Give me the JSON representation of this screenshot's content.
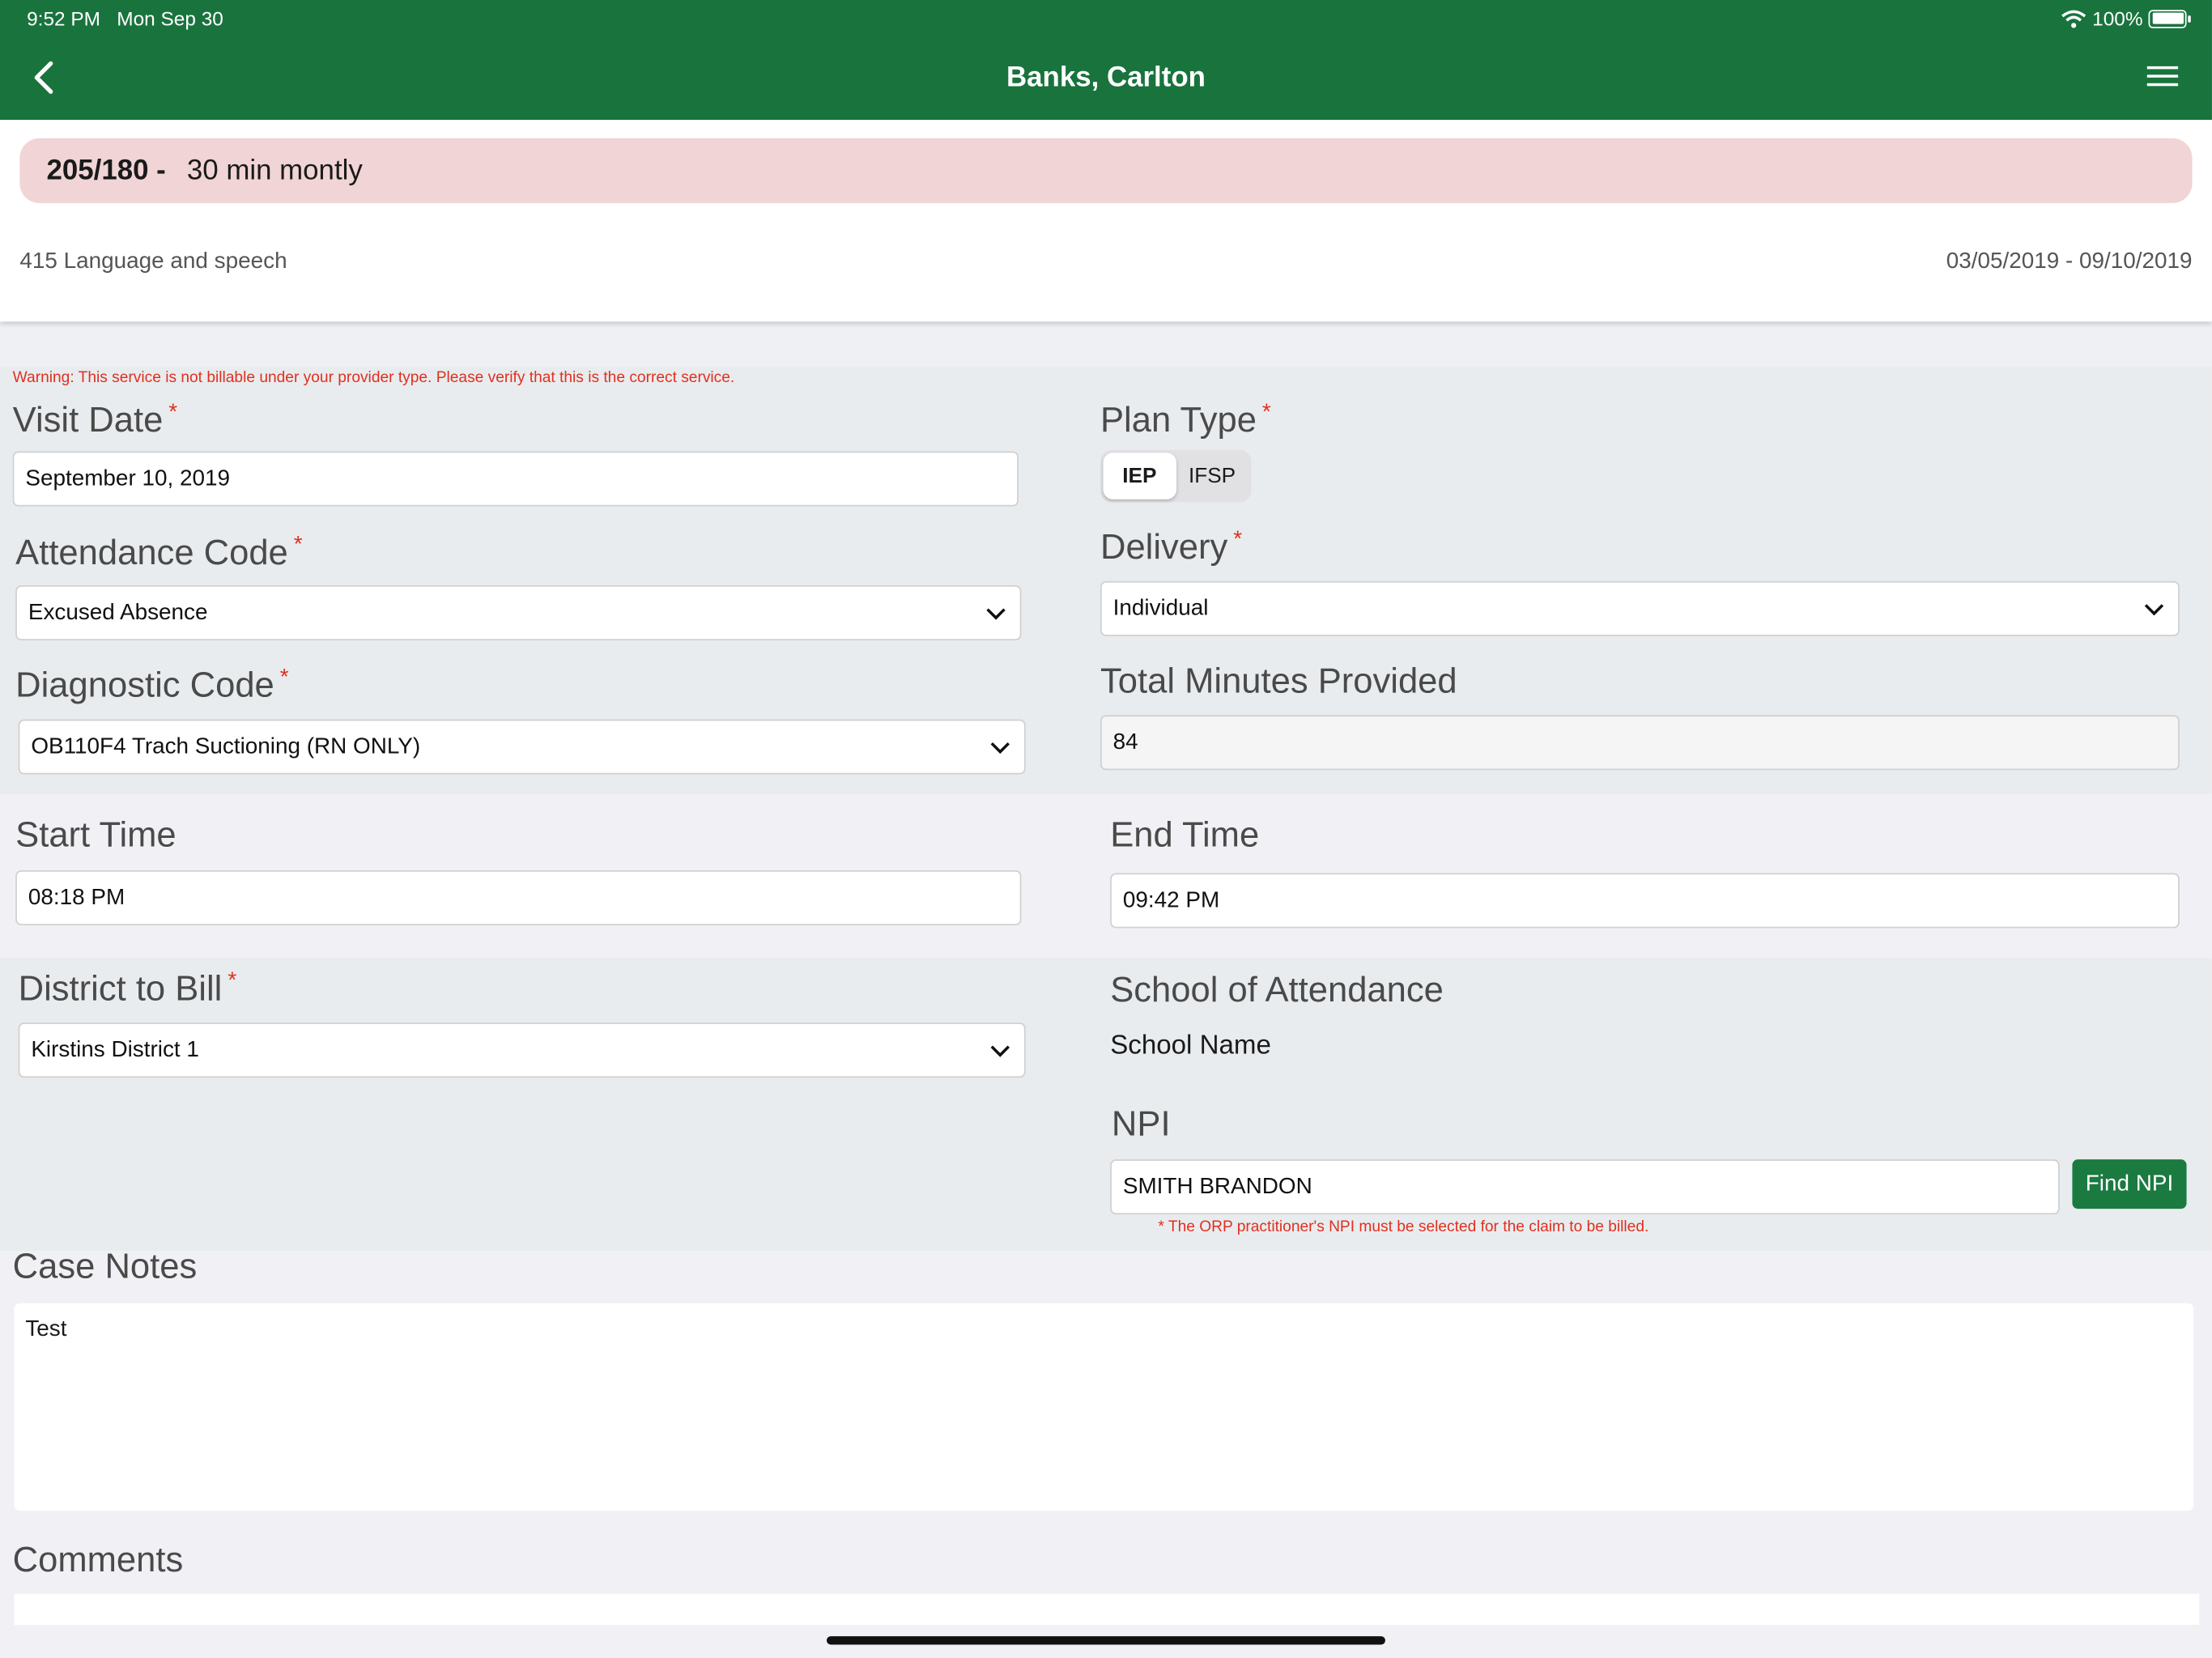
{
  "status_bar": {
    "time": "9:52 PM",
    "date": "Mon Sep 30",
    "battery": "100%"
  },
  "header": {
    "title": "Banks, Carlton"
  },
  "service": {
    "code": "205/180 -",
    "frequency": "30 min montly",
    "name": "415 Language and speech",
    "dates": "03/05/2019 - 09/10/2019"
  },
  "form": {
    "warning": "Warning: This service is not billable under your provider type. Please verify that this is the correct service.",
    "required_mark": "*",
    "visit_date": {
      "label": "Visit Date",
      "value": "September 10, 2019"
    },
    "plan_type": {
      "label": "Plan Type",
      "options": [
        "IEP",
        "IFSP"
      ],
      "selected": "IEP"
    },
    "attendance_code": {
      "label": "Attendance Code",
      "value": "Excused Absence"
    },
    "delivery": {
      "label": "Delivery",
      "value": "Individual"
    },
    "diagnostic_code": {
      "label": "Diagnostic Code",
      "value": "OB110F4 Trach Suctioning (RN ONLY)"
    },
    "total_minutes": {
      "label": "Total Minutes Provided",
      "value": "84"
    },
    "start_time": {
      "label": "Start Time",
      "value": "08:18 PM"
    },
    "end_time": {
      "label": "End Time",
      "value": "09:42 PM"
    },
    "district_to_bill": {
      "label": "District to Bill",
      "value": "Kirstins District 1"
    },
    "school_of_attendance": {
      "label": "School of Attendance",
      "value": "School Name"
    },
    "npi": {
      "label": "NPI",
      "value": "SMITH BRANDON",
      "button": "Find NPI",
      "note": "* The ORP practitioner's NPI must be selected for the claim to be billed."
    },
    "case_notes": {
      "label": "Case Notes",
      "value": "Test"
    },
    "comments": {
      "label": "Comments"
    }
  },
  "colors": {
    "header": "#19733d",
    "warning": "#e03020",
    "pill": "#f1d4d5",
    "button": "#1a7a40"
  }
}
